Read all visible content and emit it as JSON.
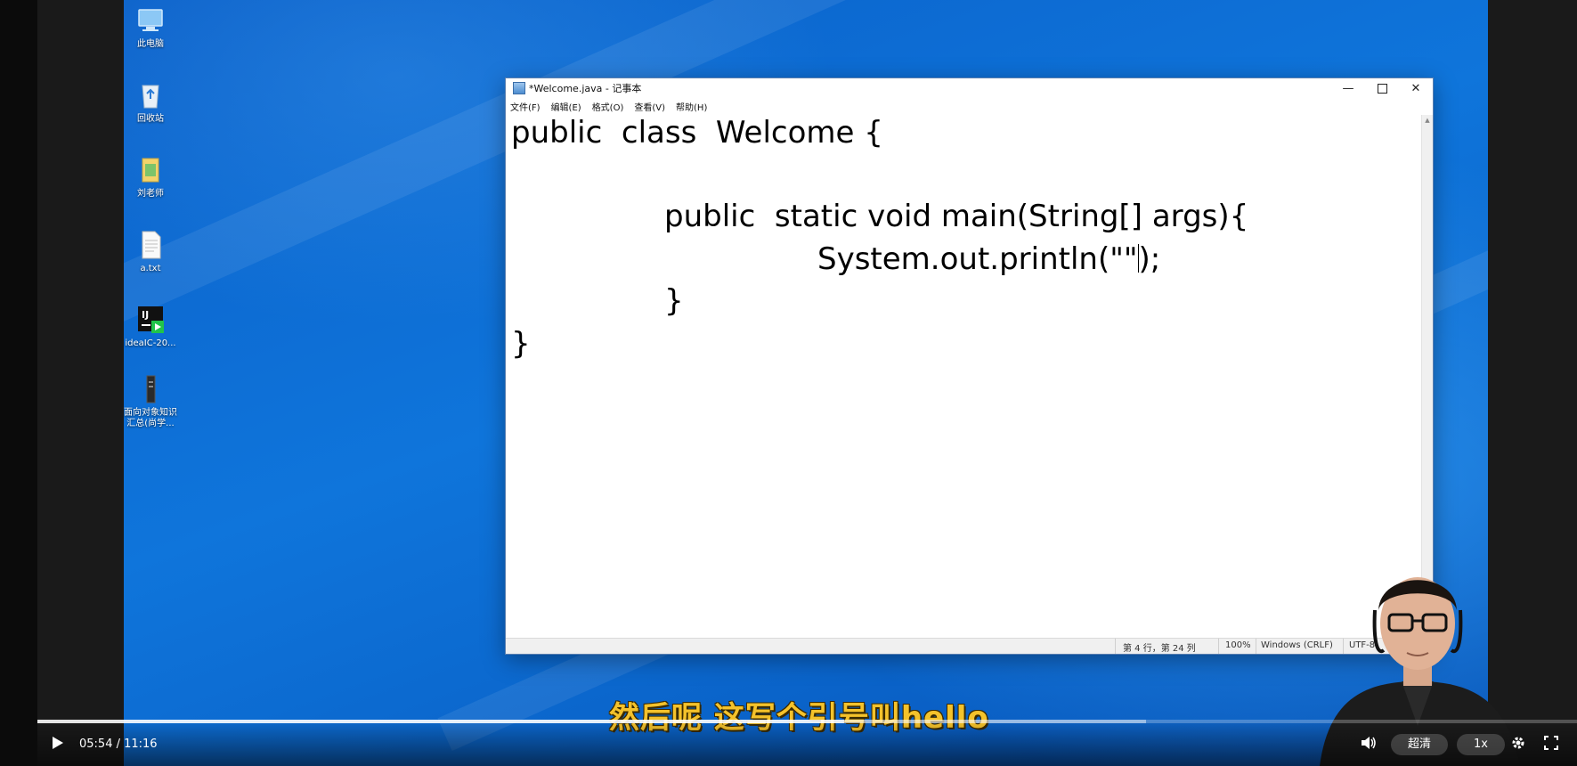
{
  "desktop": {
    "icons": [
      {
        "name": "this-pc",
        "label": "此电脑",
        "icon": "computer-icon"
      },
      {
        "name": "recycle-bin",
        "label": "回收站",
        "icon": "recycle-bin-icon"
      },
      {
        "name": "folder-liu",
        "label": "刘老师",
        "icon": "folder-icon"
      },
      {
        "name": "a-txt",
        "label": "a.txt",
        "icon": "text-file-icon"
      },
      {
        "name": "ideaic",
        "label": "ideaIC-20...",
        "icon": "intellij-icon"
      },
      {
        "name": "oop-summary",
        "label": "面向对象知识汇总(尚学...",
        "icon": "document-icon"
      }
    ]
  },
  "notepad": {
    "title": "*Welcome.java - 记事本",
    "menu": [
      "文件(F)",
      "编辑(E)",
      "格式(O)",
      "查看(V)",
      "帮助(H)"
    ],
    "code": {
      "line1": "public  class  Welcome {",
      "line2": "public  static void main(String[] args){",
      "line3_before_caret": "System.out.println(\"\"",
      "line3_after_caret": ");",
      "line4": "}",
      "line5": "}"
    },
    "status": {
      "position": "第 4 行，第 24 列",
      "zoom": "100%",
      "line_ending": "Windows (CRLF)",
      "encoding": "UTF-8"
    }
  },
  "subtitle": "然后呢 这写个引号叫hello",
  "player": {
    "time": "05:54 / 11:16",
    "quality": "超清",
    "speed": "1x",
    "progress": 0.524,
    "buffered": 0.72
  },
  "colors": {
    "subtitle": "#f4c22b",
    "desktop_blue": "#0f75db"
  }
}
